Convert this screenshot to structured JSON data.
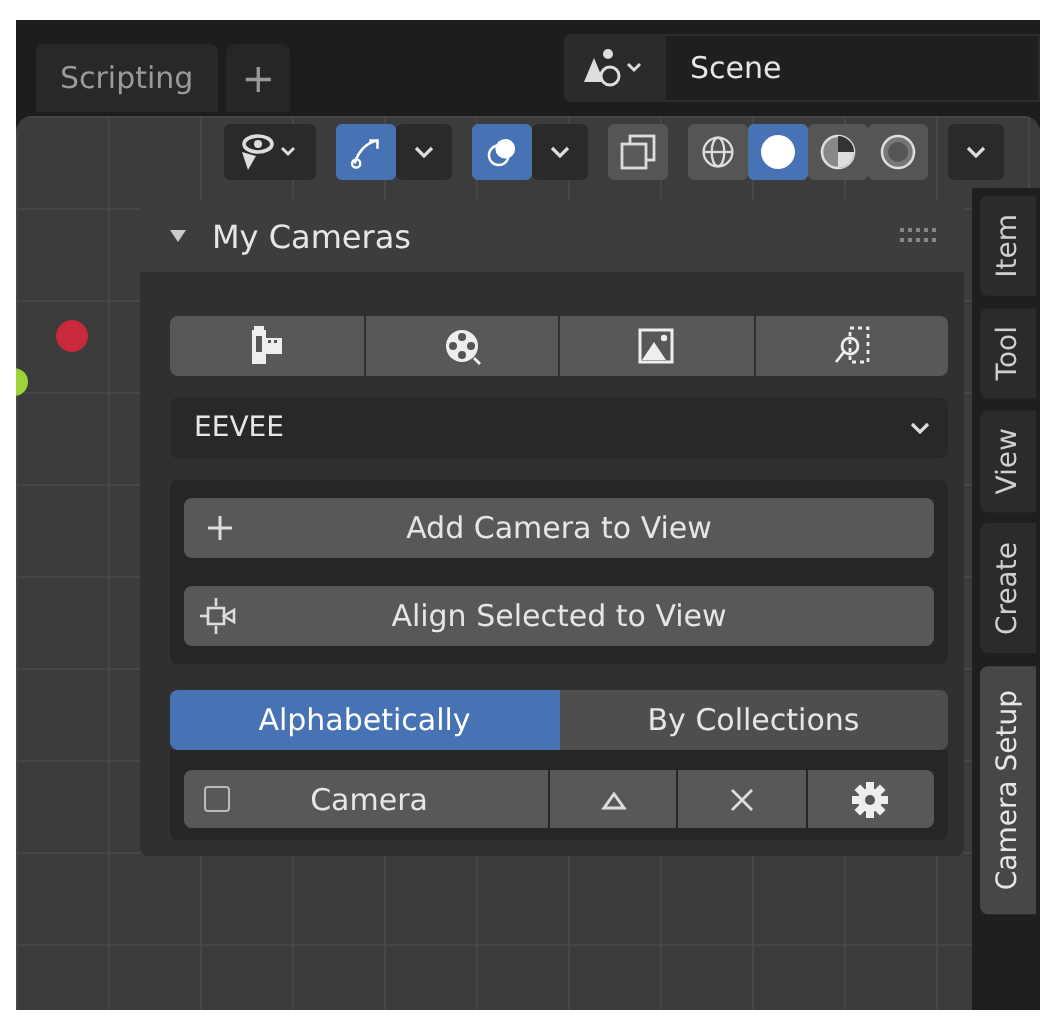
{
  "workspace_tabs": [
    {
      "label": "Scripting",
      "selected": false
    }
  ],
  "add_workspace": "+",
  "scene": {
    "name": "Scene"
  },
  "toolbar": {
    "gizmos_on": true,
    "overlays_on": true,
    "shading_modes": [
      {
        "kind": "wireframe",
        "selected": false
      },
      {
        "kind": "solid",
        "selected": true
      },
      {
        "kind": "material",
        "selected": false
      },
      {
        "kind": "rendered",
        "selected": false
      }
    ]
  },
  "panel": {
    "title": "My Cameras",
    "expanded": true,
    "icon_buttons": [
      {
        "kind": "film"
      },
      {
        "kind": "reel"
      },
      {
        "kind": "image"
      },
      {
        "kind": "zoom"
      }
    ],
    "render_engine": "EEVEE",
    "actions": [
      {
        "kind": "add",
        "label": "Add Camera to View"
      },
      {
        "kind": "align",
        "label": "Align Selected to View"
      }
    ],
    "sort_tabs": [
      {
        "label": "Alphabetically",
        "selected": true
      },
      {
        "label": "By Collections",
        "selected": false
      }
    ],
    "cameras": [
      {
        "name": "Camera",
        "checked": false
      }
    ]
  },
  "side_tabs": [
    {
      "label": "Item",
      "selected": false
    },
    {
      "label": "Tool",
      "selected": false
    },
    {
      "label": "View",
      "selected": false
    },
    {
      "label": "Create",
      "selected": false
    },
    {
      "label": "Camera Setup",
      "selected": true
    }
  ]
}
